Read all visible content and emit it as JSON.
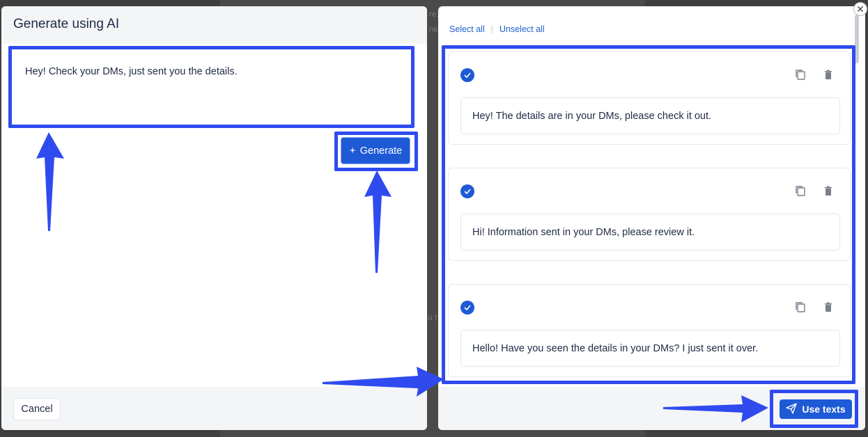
{
  "backdrop": {
    "fragments": [
      "re,",
      "nk",
      "u t"
    ]
  },
  "left_modal": {
    "title": "Generate using AI",
    "prompt_text": "Hey! Check your DMs, just sent you the details.",
    "generate_button": "Generate",
    "cancel_button": "Cancel"
  },
  "right_modal": {
    "select_all": "Select all",
    "unselect_all": "Unselect all",
    "separator": "|",
    "results": [
      {
        "text": "Hey! The details are in your DMs, please check it out.",
        "selected": true
      },
      {
        "text": "Hi! Information sent in your DMs, please review it.",
        "selected": true
      },
      {
        "text": "Hello! Have you seen the details in your DMs? I just sent it over.",
        "selected": true
      }
    ],
    "use_texts_button": "Use texts"
  },
  "colors": {
    "accent": "#1e5ad6",
    "highlight": "#2f4bf0",
    "arrow": "#2f4bf0"
  }
}
